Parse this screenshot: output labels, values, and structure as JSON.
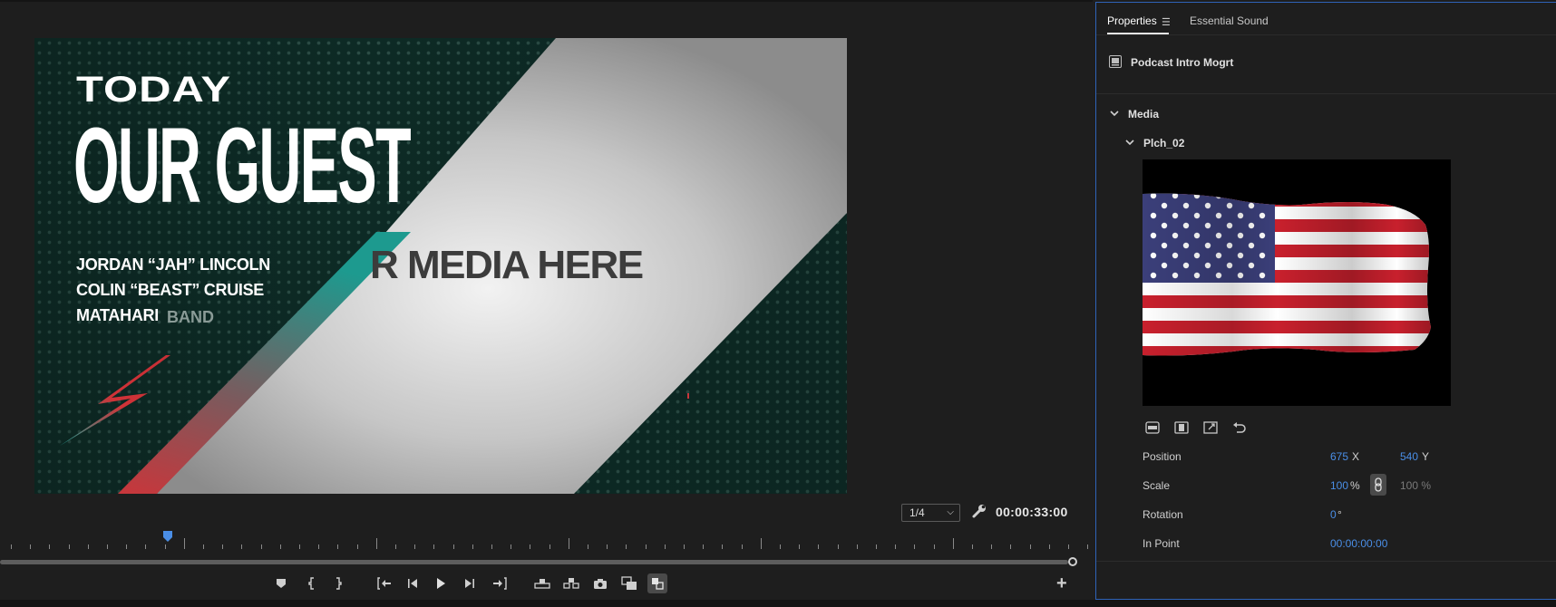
{
  "monitor": {
    "video": {
      "today": "TODAY",
      "our_guest": "OUR GUEST",
      "name1": "JORDAN “JAH” LINCOLN",
      "name2": "COLIN “BEAST” CRUISE",
      "name3": "MATAHARI",
      "name3_suffix": "BAND",
      "media_placeholder": "R MEDIA HERE"
    },
    "resolution": "1/4",
    "timecode": "00:00:33:00"
  },
  "panel": {
    "tabs": [
      "Properties",
      "Essential Sound"
    ],
    "clip_name": "Podcast Intro Mogrt",
    "section_media": "Media",
    "subsection": "Plch_02",
    "properties": {
      "position_label": "Position",
      "position_x": "675",
      "position_x_unit": "X",
      "position_y": "540",
      "position_y_unit": "Y",
      "scale_label": "Scale",
      "scale_value": "100",
      "scale_unit": "%",
      "scale_height": "100 %",
      "rotation_label": "Rotation",
      "rotation_value": "0",
      "rotation_unit": "°",
      "inpoint_label": "In Point",
      "inpoint_value": "00:00:00:00"
    }
  },
  "colors": {
    "accent_blue": "#4a8ee6",
    "panel_focus_border": "#2f63b8",
    "video_bg": "#0c2a24"
  },
  "icons": {
    "transport": [
      "add-marker-icon",
      "mark-in-icon",
      "mark-out-icon",
      "go-to-in-icon",
      "step-back-icon",
      "play-icon",
      "step-forward-icon",
      "go-to-out-icon",
      "lift-icon",
      "extract-icon",
      "export-frame-icon",
      "comparison-view-icon",
      "multicam-icon",
      "plus-icon"
    ],
    "fit": [
      "fit-width-icon",
      "fit-height-icon",
      "scale-fill-icon",
      "reset-icon"
    ]
  }
}
